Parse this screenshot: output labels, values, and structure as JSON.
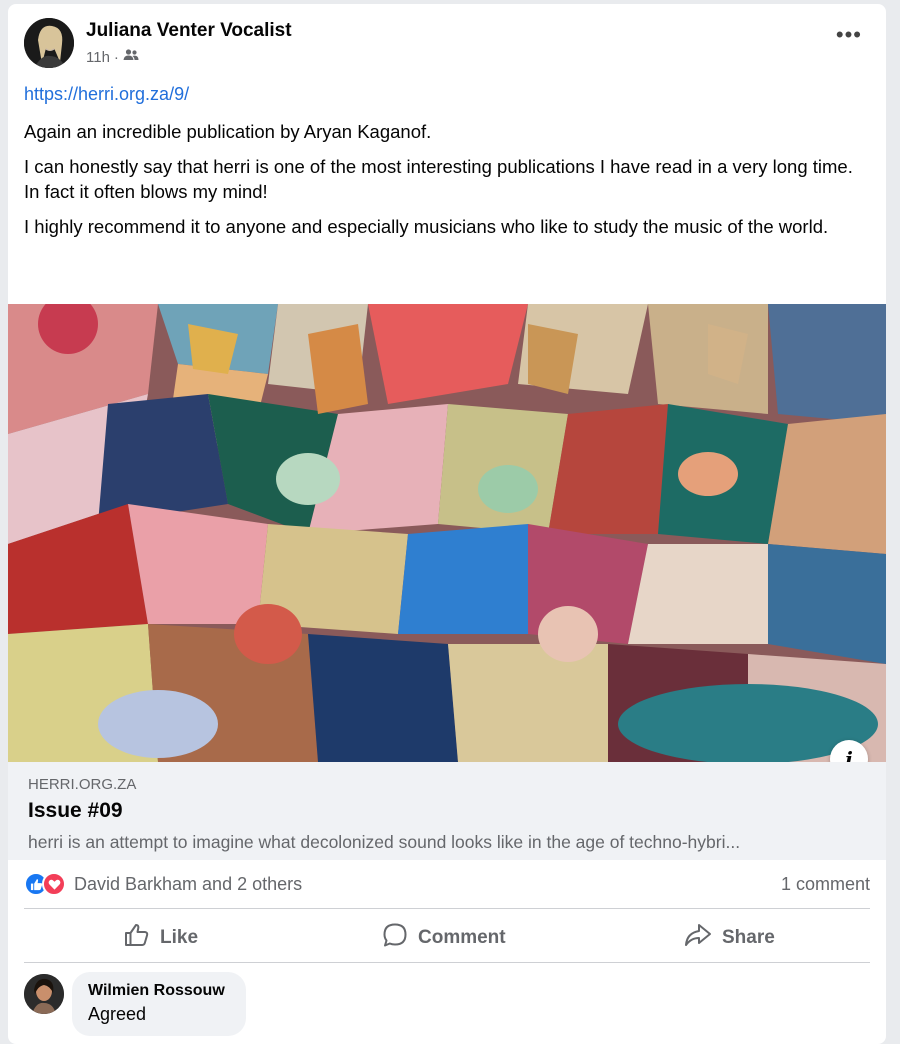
{
  "post": {
    "author": "Juliana Venter Vocalist",
    "time": "11h",
    "audience_icon": "friends-icon",
    "link": "https://herri.org.za/9/",
    "paragraphs": [
      "Again an incredible publication by Aryan Kaganof.",
      "I can honestly say that herri is one of the most interesting publications I have read in a very long time.",
      "In fact it often blows my mind!",
      "I highly recommend it to anyone and especially musicians who like to study the music of the world."
    ]
  },
  "preview": {
    "domain": "HERRI.ORG.ZA",
    "title": "Issue #09",
    "description": "herri is an attempt to imagine what decolonized sound looks like in the age of techno-hybri..."
  },
  "reactions": {
    "text": "David Barkham and 2 others",
    "icons": [
      "like-icon",
      "love-icon"
    ],
    "comments": "1 comment"
  },
  "actions": {
    "like": "Like",
    "comment": "Comment",
    "share": "Share"
  },
  "comment": {
    "author": "Wilmien Rossouw",
    "text": "Agreed"
  },
  "colors": {
    "link": "#216fdb",
    "like": "#1877f2",
    "love": "#f33e58",
    "muted": "#65676b"
  }
}
